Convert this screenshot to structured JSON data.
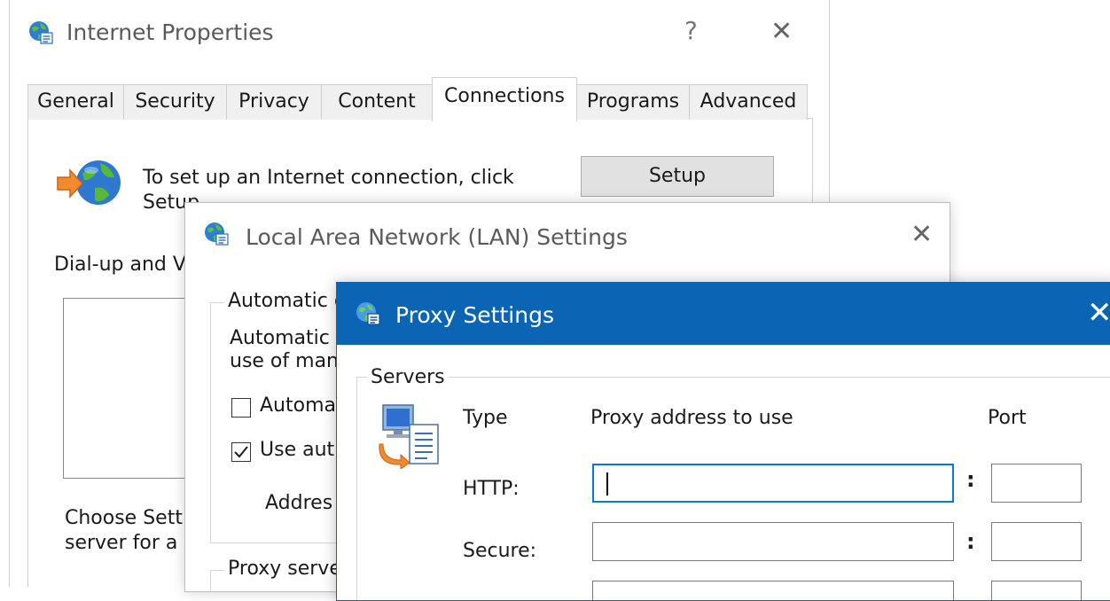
{
  "internet_properties": {
    "title": "Internet Properties",
    "help_glyph": "?",
    "close_glyph": "✕",
    "tabs": [
      "General",
      "Security",
      "Privacy",
      "Content",
      "Connections",
      "Programs",
      "Advanced"
    ],
    "active_tab": "Connections",
    "setup_text_line1": "To set up an Internet connection, click",
    "setup_text_line2": "Setup.",
    "setup_button": "Setup",
    "dialup_label": "Dial-up and Vi",
    "choose_line1": "Choose Setti",
    "choose_line2": "server for a c"
  },
  "lan_settings": {
    "title": "Local Area Network (LAN) Settings",
    "close_glyph": "✕",
    "automatic_group_label": "Automatic c",
    "auto_desc_line1": "Automatic c",
    "auto_desc_line2": "use of man",
    "auto_detect_label": "Automa",
    "auto_detect_checked": false,
    "use_script_label": "Use aut",
    "use_script_checked": true,
    "address_label": "Addres",
    "proxy_group_label": "Proxy serve"
  },
  "proxy_settings": {
    "title": "Proxy Settings",
    "close_glyph": "✕",
    "servers_label": "Servers",
    "col_type": "Type",
    "col_address": "Proxy address to use",
    "col_port": "Port",
    "rows": [
      {
        "label": "HTTP:",
        "address": "",
        "port": ""
      },
      {
        "label": "Secure:",
        "address": "",
        "port": ""
      }
    ],
    "colon": ":"
  },
  "colors": {
    "proxy_titlebar": "#0b64b4",
    "focus_border": "#0b78d7"
  },
  "icons": [
    "globe-settings-icon",
    "globe-connection-icon",
    "proxy-servers-icon",
    "checkmark-icon"
  ]
}
